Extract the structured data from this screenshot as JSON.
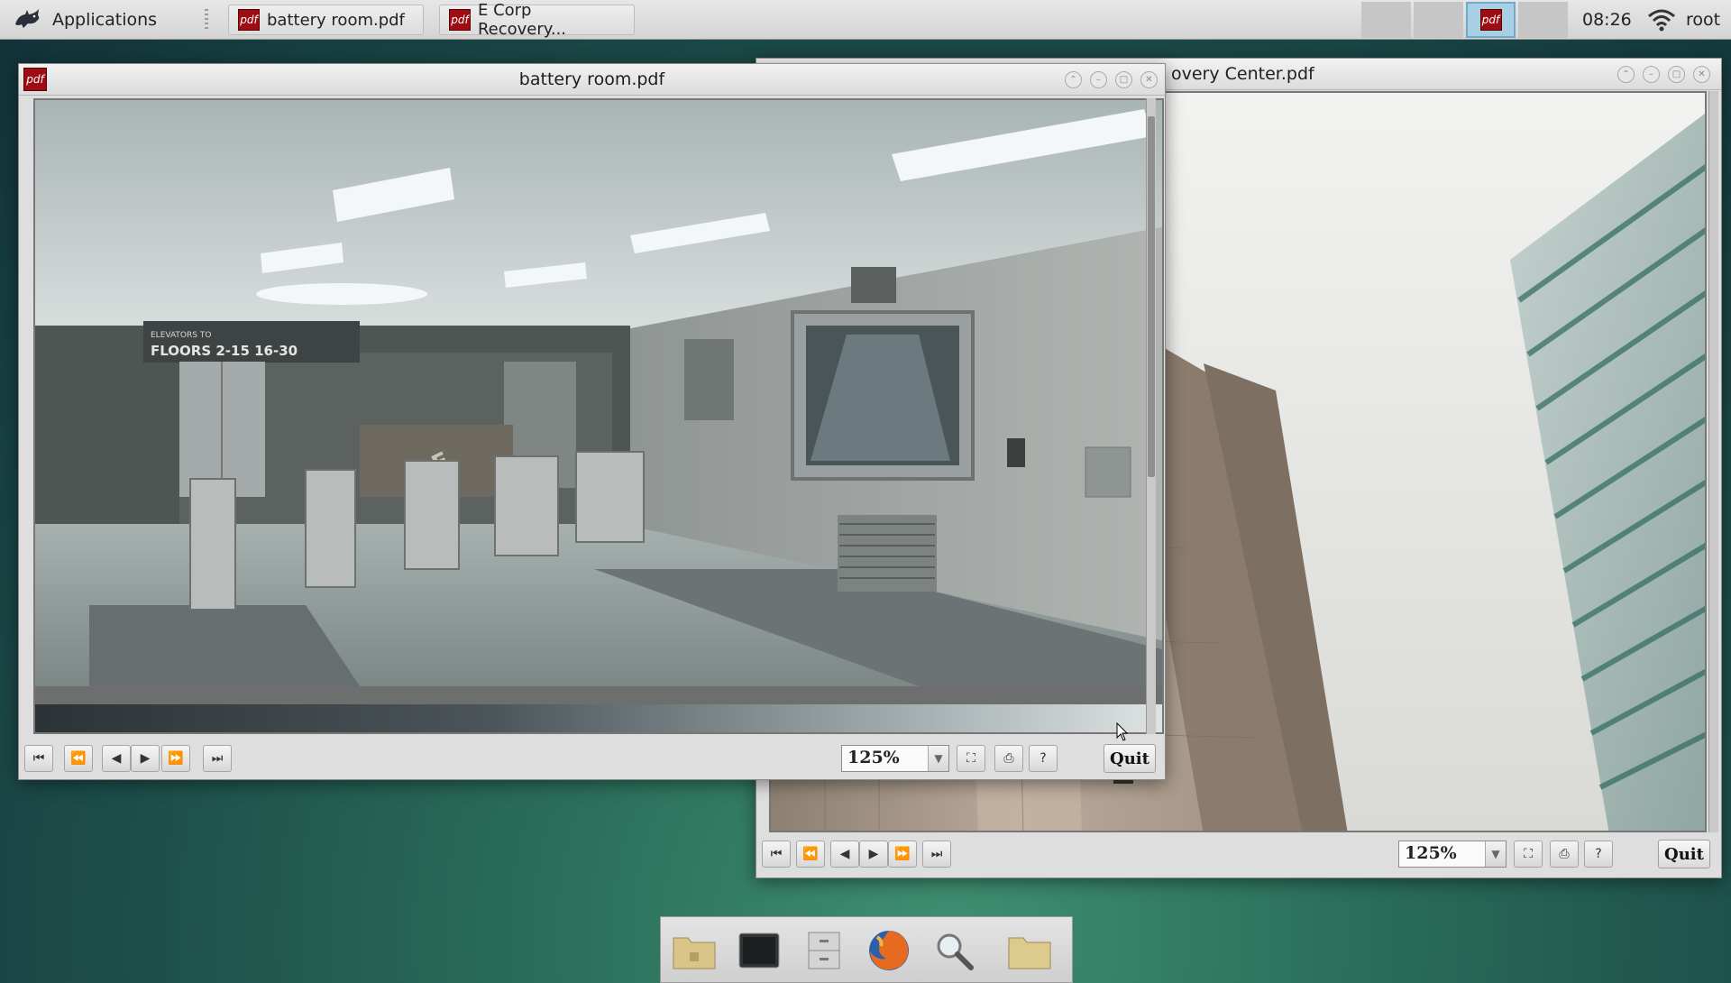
{
  "panel": {
    "apps_label": "Applications",
    "tasks": [
      {
        "label": "battery room.pdf",
        "icon": "pdf-icon"
      },
      {
        "label": "E Corp Recovery...",
        "icon": "pdf-icon"
      }
    ],
    "pdf_icon_text": "pdf",
    "clock": "08:26",
    "user": "root"
  },
  "windows": {
    "front": {
      "title": "battery room.pdf",
      "zoom": "125%",
      "quit_label": "Quit",
      "help_label": "?"
    },
    "back": {
      "title_partial": "overy Center.pdf",
      "zoom": "125%",
      "quit_label": "Quit",
      "help_label": "?"
    }
  },
  "photo_text": {
    "sign_floors": "FLOORS 2-15  16-30",
    "sign_elevators": "ELEVATORS TO",
    "logo_letter": "E"
  },
  "colors": {
    "pdf_red": "#9e0d14",
    "panel_bg": "#dcdcdc",
    "desktop_teal": "#2b6e5a",
    "workspace_active": "#a9cfe4"
  },
  "dock": {
    "items": [
      "home-folder-icon",
      "terminal-icon",
      "file-cabinet-icon",
      "firefox-icon",
      "search-icon",
      "folder-icon"
    ]
  }
}
